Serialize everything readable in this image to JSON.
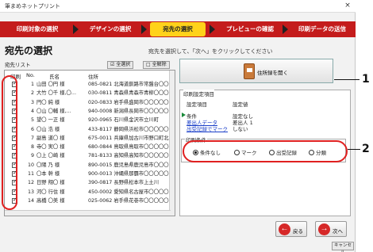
{
  "window": {
    "title": "筆まめネットプリント",
    "close_glyph": "×"
  },
  "steps": [
    {
      "label": "印刷対象の選択"
    },
    {
      "label": "デザインの選択"
    },
    {
      "label": "宛先の選択"
    },
    {
      "label": "プレビューの確認"
    },
    {
      "label": "印刷データの送信"
    }
  ],
  "page": {
    "title": "宛先の選択",
    "instruction": "宛先を選択して、「次へ」をクリックしてください"
  },
  "list": {
    "label": "宛先リスト",
    "select_all": "☑ 全選択",
    "deselect_all": "□ 全解除",
    "col_print": "印刷",
    "col_no": "No.",
    "col_name": "氏名",
    "col_addr": "住所",
    "rows": [
      {
        "no": "1",
        "name": "山田 〇円 様",
        "addr": "085-0821 北海道釧路市常盤台〇〇〇〇〇〇"
      },
      {
        "no": "2",
        "name": "大竹 〇千 様,〇…",
        "addr": "030-0811 青森県青森市青柳〇〇〇〇〇"
      },
      {
        "no": "3",
        "name": "円〇 純 様",
        "addr": "020-0833 岩手県盛岡市〇〇〇〇〇〇〇"
      },
      {
        "no": "4",
        "name": "〇山 〇輔 様,…",
        "addr": "940-0008 新潟県長岡市〇〇〇〇〇〇〇"
      },
      {
        "no": "5",
        "name": "望〇 一正 様",
        "addr": "920-0965 石川県金沢市立川町"
      },
      {
        "no": "6",
        "name": "〇山 浩 様",
        "addr": "433-8117 静岡県浜松市〇〇〇〇〇〇〇"
      },
      {
        "no": "7",
        "name": "副島 道〇 様",
        "addr": "675-0011 兵庫県加古川市野口町北野"
      },
      {
        "no": "8",
        "name": "寺〇 実〇 様",
        "addr": "680-0844 鳥取県鳥取市〇〇〇〇〇〇〇"
      },
      {
        "no": "9",
        "name": "〇上 〇崎 様",
        "addr": "781-8133 高知県高知市〇〇〇〇〇〇〇"
      },
      {
        "no": "10",
        "name": "〇隈 乃 様",
        "addr": "890-0015 鹿児島県鹿児島市〇〇〇"
      },
      {
        "no": "11",
        "name": "〇本 幹 様",
        "addr": "900-0013 沖縄県那覇市〇〇〇〇〇〇"
      },
      {
        "no": "12",
        "name": "日野 翔〇 様",
        "addr": "390-0817 長野県松本市上土川"
      },
      {
        "no": "13",
        "name": "河〇 行住 様",
        "addr": "450-0002 愛知県名古屋市〇〇〇〇"
      },
      {
        "no": "14",
        "name": "高橋 〇美 様",
        "addr": "025-0062 岩手県花巻市〇〇〇〇〇〇"
      }
    ]
  },
  "address_book_button": {
    "label": "住所録を開く"
  },
  "callouts": {
    "one": "1",
    "two": "2"
  },
  "settings": {
    "caption": "印刷設定項目",
    "col_item": "設定項目",
    "col_value": "設定値",
    "rows": [
      {
        "item": "条件",
        "value": "設定なし",
        "link": false
      },
      {
        "item": "差出人データ",
        "value": "差出人 1",
        "link": true
      },
      {
        "item": "出受記録でマーク",
        "value": "しない",
        "link": true
      }
    ]
  },
  "print_condition": {
    "caption": "印刷条件",
    "options": [
      {
        "label": "条件なし",
        "selected": true
      },
      {
        "label": "マーク",
        "selected": false
      },
      {
        "label": "出受記録",
        "selected": false
      },
      {
        "label": "分類",
        "selected": false
      }
    ]
  },
  "nav": {
    "back_label": "戻る",
    "back_glyph": "←",
    "next_label": "次へ",
    "next_glyph": "→",
    "cancel_label": "キャンセル"
  },
  "colors": {
    "step_bar": "#c41c1c",
    "step_active": "#ffd21a",
    "callout_oval": "#e02020",
    "nav_circle": "#d62828",
    "link": "#1a3ec8"
  }
}
